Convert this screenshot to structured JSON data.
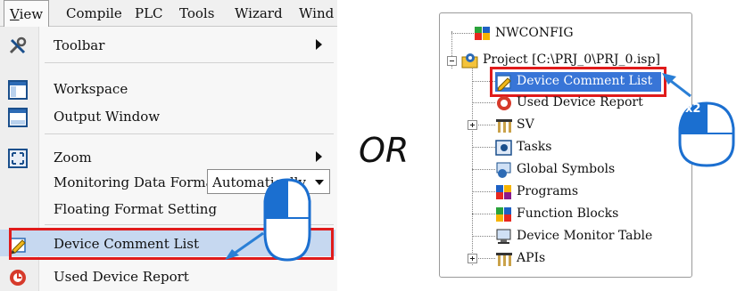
{
  "menubar": {
    "items": [
      "View",
      "Compile",
      "PLC",
      "Tools",
      "Wizard",
      "Wind"
    ]
  },
  "menu": {
    "items": [
      {
        "label": "Toolbar",
        "icon": "toolbar-icon",
        "submenu": true
      },
      {
        "label": "Workspace",
        "icon": "workspace-icon"
      },
      {
        "label": "Output Window",
        "icon": "output-window-icon"
      },
      {
        "label": "Zoom",
        "icon": "zoom-icon",
        "submenu": true
      },
      {
        "label": "Monitoring Data Format"
      },
      {
        "label": "Floating Format Setting"
      },
      {
        "label": "Device Comment List",
        "icon": "device-comment-list-icon",
        "highlighted": true
      },
      {
        "label": "Used Device Report",
        "icon": "used-device-report-icon"
      }
    ],
    "monitoring_format_value": "Automatically"
  },
  "or_label": "OR",
  "tree": {
    "items": [
      {
        "label": "NWCONFIG",
        "icon": "nwconfig-icon"
      },
      {
        "label": "Project [C:\\PRJ_0\\PRJ_0.isp]",
        "icon": "project-icon"
      },
      {
        "label": "Device Comment List",
        "icon": "device-comment-list-icon",
        "highlighted": true
      },
      {
        "label": "Used Device Report",
        "icon": "used-device-report-icon"
      },
      {
        "label": "SV",
        "icon": "sv-icon"
      },
      {
        "label": "Tasks",
        "icon": "tasks-icon"
      },
      {
        "label": "Global Symbols",
        "icon": "global-symbols-icon"
      },
      {
        "label": "Programs",
        "icon": "programs-icon"
      },
      {
        "label": "Function Blocks",
        "icon": "function-blocks-icon"
      },
      {
        "label": "Device Monitor Table",
        "icon": "device-monitor-table-icon"
      },
      {
        "label": "APIs",
        "icon": "apis-icon"
      }
    ]
  },
  "double_click_label": "x2",
  "colors": {
    "highlight_box": "#e01b1b",
    "arrow": "#2a7fd6",
    "selection": "#c6d8f0"
  }
}
